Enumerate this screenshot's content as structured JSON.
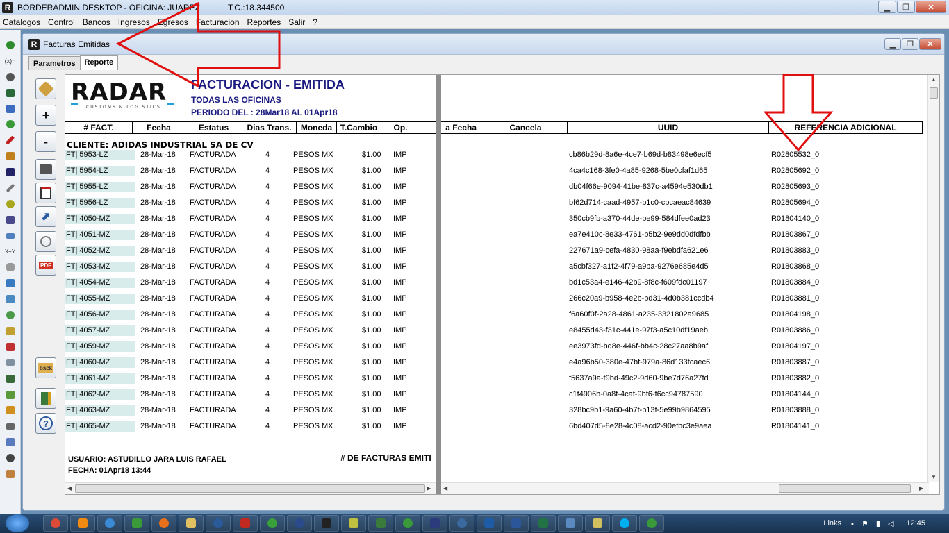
{
  "app": {
    "title": "BORDERADMIN DESKTOP - OFICINA: JUAREZ",
    "title_extra": "T.C.:18.344500",
    "logo_letter": "R"
  },
  "menu": [
    "Catalogos",
    "Control",
    "Bancos",
    "Ingresos",
    "Egresos",
    "Facturacion",
    "Reportes",
    "Salir",
    "?"
  ],
  "child": {
    "title": "Facturas Emitidas",
    "tabs": [
      {
        "label": "Parametros",
        "active": false
      },
      {
        "label": "Reporte",
        "active": true
      }
    ]
  },
  "tools": {
    "zoom_in": "+",
    "zoom_out": "-",
    "pdf": "PDF",
    "help": "?",
    "folder": "back"
  },
  "report": {
    "logo_text": "RADAR",
    "logo_sub": "CUSTOMS & LOGISTICS",
    "title": "FACTURACION - EMITIDA",
    "subtitle": "TODAS LAS OFICINAS",
    "period": "PERIODO DEL : 28Mar18 AL 01Apr18",
    "columns": [
      "# FACT.",
      "Fecha",
      "Estatus",
      "Dias Trans.",
      "Moneda",
      "T.Cambio",
      "Op.",
      "a Fecha",
      "Cancela",
      "UUID",
      "REFERENCIA ADICIONAL"
    ],
    "client": "CLIENTE: ADIDAS INDUSTRIAL SA DE CV",
    "rows": [
      {
        "fact": "FT| 5953-LZ",
        "fecha": "28-Mar-18",
        "estatus": "FACTURADA",
        "dias": "4",
        "moneda": "PESOS MX",
        "tc": "$1.00",
        "op": "IMP",
        "uuid": "cb86b29d-8a6e-4ce7-b69d-b83498e6ecf5",
        "ref": "R02805532_0"
      },
      {
        "fact": "FT| 5954-LZ",
        "fecha": "28-Mar-18",
        "estatus": "FACTURADA",
        "dias": "4",
        "moneda": "PESOS MX",
        "tc": "$1.00",
        "op": "IMP",
        "uuid": "4ca4c168-3fe0-4a85-9268-5be0cfaf1d65",
        "ref": "R02805692_0"
      },
      {
        "fact": "FT| 5955-LZ",
        "fecha": "28-Mar-18",
        "estatus": "FACTURADA",
        "dias": "4",
        "moneda": "PESOS MX",
        "tc": "$1.00",
        "op": "IMP",
        "uuid": "db04f66e-9094-41be-837c-a4594e530db1",
        "ref": "R02805693_0"
      },
      {
        "fact": "FT| 5956-LZ",
        "fecha": "28-Mar-18",
        "estatus": "FACTURADA",
        "dias": "4",
        "moneda": "PESOS MX",
        "tc": "$1.00",
        "op": "IMP",
        "uuid": "bf62d714-caad-4957-b1c0-cbcaeac84639",
        "ref": "R02805694_0"
      },
      {
        "fact": "FT| 4050-MZ",
        "fecha": "28-Mar-18",
        "estatus": "FACTURADA",
        "dias": "4",
        "moneda": "PESOS MX",
        "tc": "$1.00",
        "op": "IMP",
        "uuid": "350cb9fb-a370-44de-be99-584dfee0ad23",
        "ref": "R01804140_0"
      },
      {
        "fact": "FT| 4051-MZ",
        "fecha": "28-Mar-18",
        "estatus": "FACTURADA",
        "dias": "4",
        "moneda": "PESOS MX",
        "tc": "$1.00",
        "op": "IMP",
        "uuid": "ea7e410c-8e33-4761-b5b2-9e9dd0dfdfbb",
        "ref": "R01803867_0"
      },
      {
        "fact": "FT| 4052-MZ",
        "fecha": "28-Mar-18",
        "estatus": "FACTURADA",
        "dias": "4",
        "moneda": "PESOS MX",
        "tc": "$1.00",
        "op": "IMP",
        "uuid": "227671a9-cefa-4830-98aa-f9ebdfa621e6",
        "ref": "R01803883_0"
      },
      {
        "fact": "FT| 4053-MZ",
        "fecha": "28-Mar-18",
        "estatus": "FACTURADA",
        "dias": "4",
        "moneda": "PESOS MX",
        "tc": "$1.00",
        "op": "IMP",
        "uuid": "a5cbf327-a1f2-4f79-a9ba-9276e685e4d5",
        "ref": "R01803868_0"
      },
      {
        "fact": "FT| 4054-MZ",
        "fecha": "28-Mar-18",
        "estatus": "FACTURADA",
        "dias": "4",
        "moneda": "PESOS MX",
        "tc": "$1.00",
        "op": "IMP",
        "uuid": "bd1c53a4-e146-42b9-8f8c-f609fdc01197",
        "ref": "R01803884_0"
      },
      {
        "fact": "FT| 4055-MZ",
        "fecha": "28-Mar-18",
        "estatus": "FACTURADA",
        "dias": "4",
        "moneda": "PESOS MX",
        "tc": "$1.00",
        "op": "IMP",
        "uuid": "266c20a9-b958-4e2b-bd31-4d0b381ccdb4",
        "ref": "R01803881_0"
      },
      {
        "fact": "FT| 4056-MZ",
        "fecha": "28-Mar-18",
        "estatus": "FACTURADA",
        "dias": "4",
        "moneda": "PESOS MX",
        "tc": "$1.00",
        "op": "IMP",
        "uuid": "f6a60f0f-2a28-4861-a235-3321802a9685",
        "ref": "R01804198_0"
      },
      {
        "fact": "FT| 4057-MZ",
        "fecha": "28-Mar-18",
        "estatus": "FACTURADA",
        "dias": "4",
        "moneda": "PESOS MX",
        "tc": "$1.00",
        "op": "IMP",
        "uuid": "e8455d43-f31c-441e-97f3-a5c10df19aeb",
        "ref": "R01803886_0"
      },
      {
        "fact": "FT| 4059-MZ",
        "fecha": "28-Mar-18",
        "estatus": "FACTURADA",
        "dias": "4",
        "moneda": "PESOS MX",
        "tc": "$1.00",
        "op": "IMP",
        "uuid": "ee3973fd-bd8e-446f-bb4c-28c27aa8b9af",
        "ref": "R01804197_0"
      },
      {
        "fact": "FT| 4060-MZ",
        "fecha": "28-Mar-18",
        "estatus": "FACTURADA",
        "dias": "4",
        "moneda": "PESOS MX",
        "tc": "$1.00",
        "op": "IMP",
        "uuid": "e4a96b50-380e-47bf-979a-86d133fcaec6",
        "ref": "R01803887_0"
      },
      {
        "fact": "FT| 4061-MZ",
        "fecha": "28-Mar-18",
        "estatus": "FACTURADA",
        "dias": "4",
        "moneda": "PESOS MX",
        "tc": "$1.00",
        "op": "IMP",
        "uuid": "f5637a9a-f9bd-49c2-9d60-9be7d76a27fd",
        "ref": "R01803882_0"
      },
      {
        "fact": "FT| 4062-MZ",
        "fecha": "28-Mar-18",
        "estatus": "FACTURADA",
        "dias": "4",
        "moneda": "PESOS MX",
        "tc": "$1.00",
        "op": "IMP",
        "uuid": "c1f4906b-0a8f-4caf-9bf6-f6cc94787590",
        "ref": "R01804144_0"
      },
      {
        "fact": "FT| 4063-MZ",
        "fecha": "28-Mar-18",
        "estatus": "FACTURADA",
        "dias": "4",
        "moneda": "PESOS MX",
        "tc": "$1.00",
        "op": "IMP",
        "uuid": "328bc9b1-9a60-4b7f-b13f-5e99b9864595",
        "ref": "R01803888_0"
      },
      {
        "fact": "FT| 4065-MZ",
        "fecha": "28-Mar-18",
        "estatus": "FACTURADA",
        "dias": "4",
        "moneda": "PESOS MX",
        "tc": "$1.00",
        "op": "IMP",
        "uuid": "6bd407d5-8e28-4c08-acd2-90efbc3e9aea",
        "ref": "R01804141_0"
      }
    ],
    "footer_user": "USUARIO: ASTUDILLO JARA LUIS RAFAEL",
    "footer_date": "FECHA: 01Apr18 13:44",
    "footer_count": "# DE FACTURAS EMITI"
  },
  "taskbar": {
    "tray_links": "Links",
    "clock": "12:45"
  },
  "colors": {
    "report_title": "#1a1a80",
    "fact_cell_bg": "#d9ecec",
    "annotation_red": "#e01010"
  }
}
